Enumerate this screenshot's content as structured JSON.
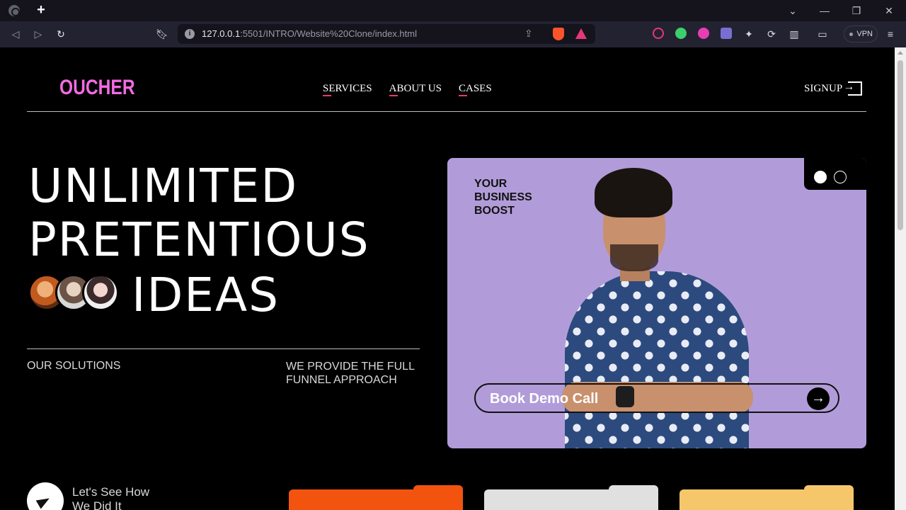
{
  "browser": {
    "url_host": "127.0.0.1",
    "url_path": ":5501/INTRO/Website%20Clone/index.html",
    "vpn_label": "VPN",
    "new_tab_icon": "plus-icon"
  },
  "site": {
    "logo": "OUCHER",
    "nav": [
      "SERVICES",
      "ABOUT US",
      "CASES"
    ],
    "signup": "SIGNUP"
  },
  "hero": {
    "line1": "UNLIMITED",
    "line2": "PRETENTIOUS",
    "line3": "IDEAS",
    "solutions_label": "OUR SOLUTIONS",
    "funnel_text": "WE PROVIDE THE FULL FUNNEL APPROACH"
  },
  "card": {
    "background": "#b19cd9",
    "tagline": "YOUR BUSINESS BOOST",
    "cta_label": "Book Demo Call",
    "slide_count": 2,
    "active_slide": 1
  },
  "bottom": {
    "see_label": "Let's See How We Did It",
    "folder_colors": [
      "#f25410",
      "#e0e0e0",
      "#f6c76a"
    ]
  },
  "colors": {
    "accent_pink": "#f26be1",
    "underline": "#e6377b"
  }
}
